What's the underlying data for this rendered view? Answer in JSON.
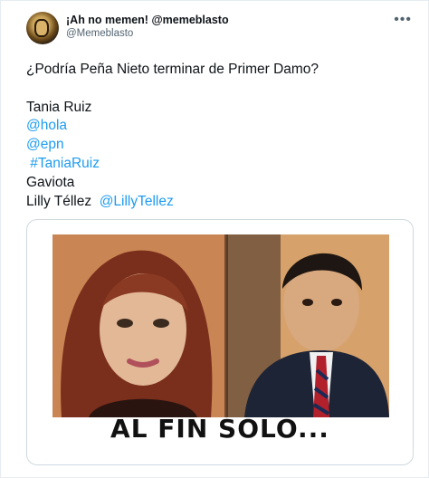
{
  "author": {
    "name": "¡Ah no memen! @memeblasto",
    "handle": "@Memeblasto",
    "avatar_icon": "avatar-photo-icon"
  },
  "menu": {
    "more_label": "•••"
  },
  "tweet": {
    "line1": "¿Podría Peña Nieto terminar de Primer Damo?",
    "line2": "Tania Ruiz",
    "line3": "@hola",
    "line4": "@epn",
    "line5": " #TaniaRuiz",
    "line6": "Gaviota",
    "line7_text": "Lilly Téllez  ",
    "line7_link": "@LillyTellez"
  },
  "media": {
    "caption": "AL FIN SOLO..."
  },
  "colors": {
    "link": "#1d9bf0",
    "text": "#0f1419",
    "secondary": "#536471"
  }
}
